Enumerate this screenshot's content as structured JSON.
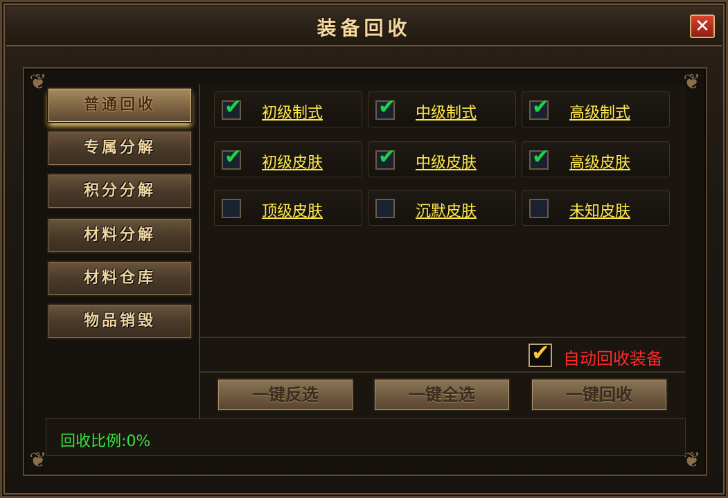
{
  "window": {
    "title": "装备回收",
    "close_label": "✕"
  },
  "sidebar": {
    "items": [
      {
        "label": "普通回收",
        "active": true
      },
      {
        "label": "专属分解",
        "active": false
      },
      {
        "label": "积分分解",
        "active": false
      },
      {
        "label": "材料分解",
        "active": false
      },
      {
        "label": "材料仓库",
        "active": false
      },
      {
        "label": "物品销毁",
        "active": false
      }
    ]
  },
  "options": [
    {
      "label": "初级制式",
      "checked": true
    },
    {
      "label": "中级制式",
      "checked": true
    },
    {
      "label": "高级制式",
      "checked": true
    },
    {
      "label": "初级皮肤",
      "checked": true
    },
    {
      "label": "中级皮肤",
      "checked": true
    },
    {
      "label": "高级皮肤",
      "checked": true
    },
    {
      "label": "顶级皮肤",
      "checked": false
    },
    {
      "label": "沉默皮肤",
      "checked": false
    },
    {
      "label": "未知皮肤",
      "checked": false
    }
  ],
  "auto_recycle": {
    "label": "自动回收装备",
    "checked": true
  },
  "actions": {
    "invert_label": "一键反选",
    "select_all_label": "一键全选",
    "recycle_label": "一键回收"
  },
  "footer": {
    "ratio_text": "回收比例:0%"
  },
  "colors": {
    "option_text": "#ffe94a",
    "auto_text": "#ff2a2a",
    "ratio_text": "#33e33e",
    "check_green": "#1fd34a"
  }
}
